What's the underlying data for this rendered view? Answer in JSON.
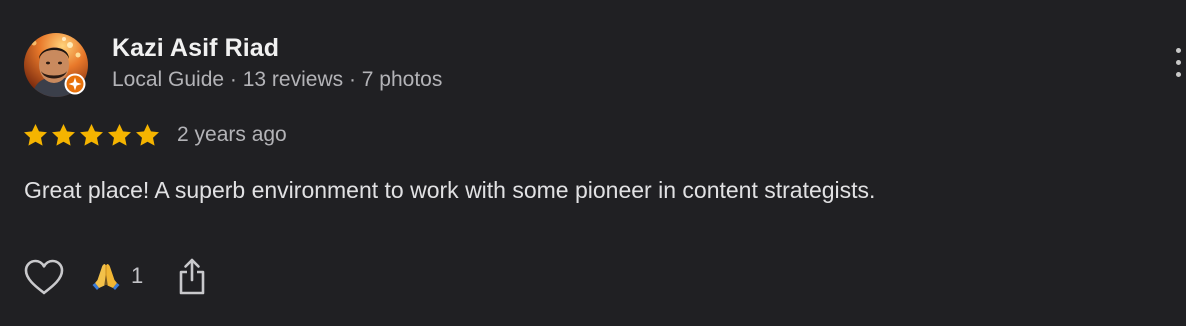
{
  "reviewer": {
    "name": "Kazi Asif Riad",
    "meta": "Local Guide · 13 reviews · 7 photos",
    "avatar_icon": "profile-photo",
    "badge_icon": "local-guide-badge-icon"
  },
  "review": {
    "rating": 5,
    "rating_max": 5,
    "date": "2 years ago",
    "text": "Great place! A superb environment to work with some pioneer in content strategists."
  },
  "actions": {
    "like_icon": "heart-outline-icon",
    "reaction_icon": "folded-hands-emoji",
    "reaction_count": "1",
    "share_icon": "share-icon",
    "more_icon": "more-vertical-icon"
  },
  "colors": {
    "background": "#202023",
    "star": "#f5b400",
    "badge": "#e8710a",
    "primary_text": "#f1f1f1",
    "secondary_text": "#b3b3b7"
  }
}
